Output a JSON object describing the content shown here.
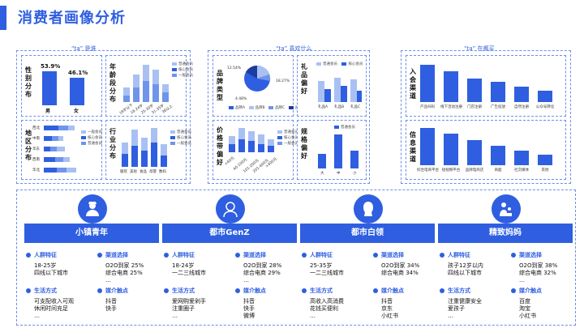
{
  "page": {
    "title": "消费者画像分析"
  },
  "sections": {
    "who": "“ta” 是谁",
    "likes": "“ta” 喜欢什么",
    "where": "“ta” 在哪买"
  },
  "gender": {
    "label": "性别分布",
    "male_pct": "53.9%",
    "female_pct": "46.1%",
    "male": "男",
    "female": "女"
  },
  "age": {
    "label": "年龄段分布",
    "ticks": [
      "18岁以下",
      "18-24岁",
      "25-30岁",
      "31-35岁",
      "36以上"
    ],
    "legend": [
      "普通会员",
      "核心会员",
      "一般会员"
    ]
  },
  "region": {
    "label": "地区分布",
    "rows": [
      "西北",
      "中南",
      "华东",
      "西南",
      "华北"
    ],
    "legend": [
      "一般会员",
      "核心会员",
      "普通会员"
    ]
  },
  "industry": {
    "label": "行业分布",
    "ticks": [
      "服装",
      "美妆",
      "食品",
      "母婴",
      "数码"
    ],
    "legend": [
      "普通会员",
      "核心会员",
      "一般会员"
    ]
  },
  "brand": {
    "label": "品牌类型",
    "pcts": [
      "12.54%",
      "4.48%",
      "18.27%"
    ],
    "legend": [
      "品牌A",
      "品牌B",
      "品牌C",
      "品牌D"
    ]
  },
  "gift": {
    "label": "礼品偏好",
    "ticks": [
      "礼品A",
      "礼品B",
      "礼品C"
    ],
    "legend": [
      "普通会员",
      "核心会员"
    ]
  },
  "price": {
    "label": "价格带偏好",
    "ticks": [
      "<40元",
      "40-100元",
      "101-200元",
      "201-400元",
      ">400元"
    ],
    "legend": [
      "普通会员",
      "核心会员",
      "一般会员"
    ]
  },
  "spec": {
    "label": "规格偏好",
    "ticks": [
      "大",
      "中",
      "小"
    ],
    "legend": [
      "普通会员"
    ]
  },
  "entry": {
    "label": "入会渠道",
    "ticks": [
      "产品扫码",
      "线下活动注册",
      "门店注册",
      "广告投放",
      "自然注册",
      "公众号转化"
    ],
    "values": [
      100,
      82,
      62,
      55,
      42,
      30
    ]
  },
  "info": {
    "label": "信息渠道",
    "ticks": [
      "综合电商平台",
      "短视频平台",
      "品牌电商店",
      "商超",
      "社交媒体",
      "其他"
    ],
    "values": [
      100,
      85,
      68,
      52,
      40,
      28
    ]
  },
  "personas": [
    {
      "name": "小镇青年",
      "h1": "人群特征",
      "h2": "渠道选择",
      "h3": "生活方式",
      "h4": "媒介触点",
      "t1": "18-25岁\n四线以下城市",
      "t2": "O2O到家 25%\n综合电商 25%\n…",
      "t3": "可支配收入可观\n休闲时间充足\n…",
      "t4": "抖音\n快手"
    },
    {
      "name": "都市GenZ",
      "h1": "人群特征",
      "h2": "渠道选择",
      "h3": "生活方式",
      "h4": "媒介触点",
      "t1": "18-24岁\n一二三线城市",
      "t2": "O2O到家 28%\n综合电商 29%\n…",
      "t3": "爱网购爱剁手\n注重圈子\n…",
      "t4": "抖音\n快手\n微博"
    },
    {
      "name": "都市白领",
      "h1": "人群特征",
      "h2": "渠道选择",
      "h3": "生活方式",
      "h4": "媒介触点",
      "t1": "25-35岁\n一二三线城市",
      "t2": "O2O到家 34%\n综合电商 34%",
      "t3": "高收入高消费\n花钱买便利\n…",
      "t4": "抖音\n京东\n小红书"
    },
    {
      "name": "精致妈妈",
      "h1": "人群特征",
      "h2": "渠道选择",
      "h3": "生活方式",
      "h4": "媒介触点",
      "t1": "孩子12岁以内\n四线以下城市",
      "t2": "O2O到家 38%\n综合电商 32%\n…",
      "t3": "注重健康安全\n爱孩子\n…",
      "t4": "百度\n淘宝\n小红书"
    }
  ]
}
